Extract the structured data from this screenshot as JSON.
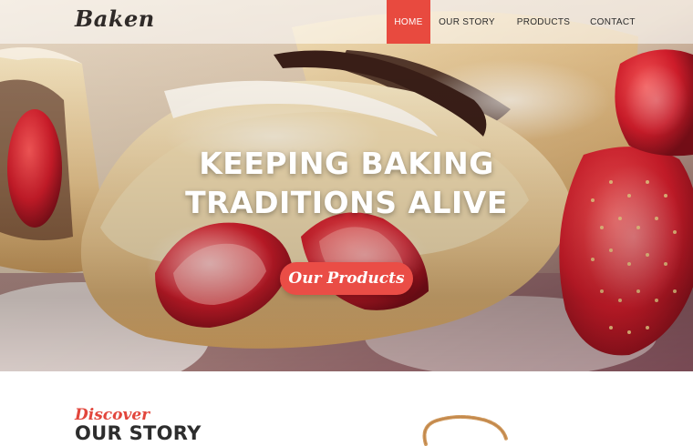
{
  "brand": {
    "logo": "Baken"
  },
  "nav": {
    "items": [
      {
        "label": "HOME",
        "active": true
      },
      {
        "label": "OUR STORY",
        "active": false
      },
      {
        "label": "PRODUCTS",
        "active": false
      },
      {
        "label": "CONTACT",
        "active": false
      }
    ]
  },
  "hero": {
    "headline_line1": "KEEPING BAKING",
    "headline_line2": "TRADITIONS ALIVE",
    "cta_label": "Our Products"
  },
  "story": {
    "kicker": "Discover",
    "title": "OUR STORY"
  },
  "colors": {
    "accent": "#e84a3f",
    "text_dark": "#2d2d2d"
  }
}
